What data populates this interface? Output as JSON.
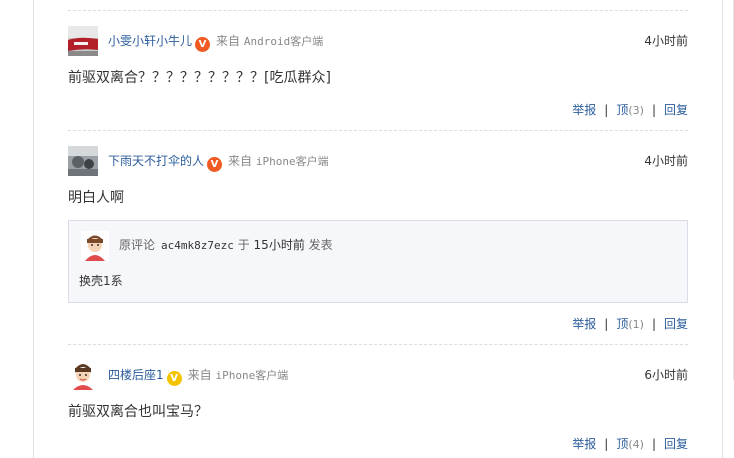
{
  "comments": [
    {
      "username": "小雯小轩小牛儿",
      "badge_color": "#f15a22",
      "badge_icon": "verified-icon",
      "from_label": "来自",
      "client": "Android客户端",
      "time": "4小时前",
      "content": "前驱双离合？？？？？？？？？[吃瓜群众]",
      "actions": {
        "report": "举报",
        "up": "顶",
        "up_count": "(3)",
        "reply": "回复"
      }
    },
    {
      "username": "下雨天不打伞的人",
      "badge_color": "#f15a22",
      "badge_icon": "verified-icon",
      "from_label": "来自",
      "client": "iPhone客户端",
      "time": "4小时前",
      "content": "明白人啊",
      "quote": {
        "label": "原评论",
        "user": "ac4mk8z7ezc",
        "prep": "于",
        "time": "15小时前",
        "verb": "发表",
        "text": "换壳1系"
      },
      "actions": {
        "report": "举报",
        "up": "顶",
        "up_count": "(1)",
        "reply": "回复"
      }
    },
    {
      "username": "四楼后座1",
      "badge_color": "#f4c300",
      "badge_icon": "verified-icon",
      "from_label": "来自",
      "client": "iPhone客户端",
      "time": "6小时前",
      "content": "前驱双离合也叫宝马？",
      "actions": {
        "report": "举报",
        "up": "顶",
        "up_count": "(4)",
        "reply": "回复"
      }
    }
  ],
  "separator": "|",
  "badge_letter": "V"
}
